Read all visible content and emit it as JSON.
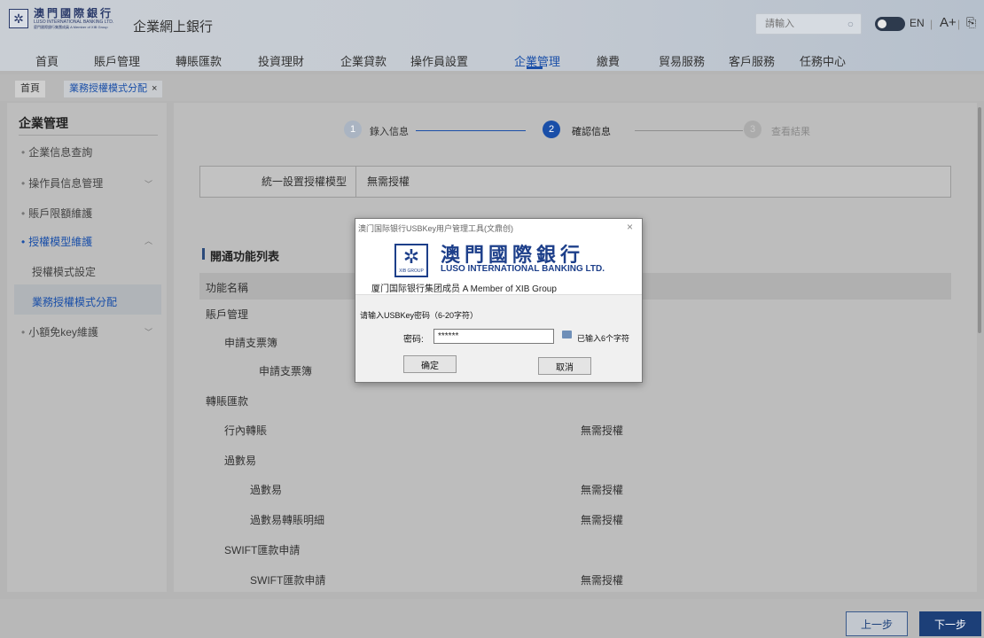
{
  "header": {
    "logo_cn": "澳門國際銀行",
    "logo_en": "LUSO INTERNATIONAL BANKING LTD.",
    "logo_sub": "廈門國際銀行集團成員 A Member of XIB Group",
    "site_name": "企業網上銀行",
    "search_placeholder": "請輸入",
    "lang": "EN",
    "font_size": "A+",
    "nav": [
      {
        "label": "首頁"
      },
      {
        "label": "賬戶管理"
      },
      {
        "label": "轉賬匯款"
      },
      {
        "label": "投資理財"
      },
      {
        "label": "企業貸款"
      },
      {
        "label": "操作員設置"
      },
      {
        "label": "企業管理",
        "active": true
      },
      {
        "label": "繳費"
      },
      {
        "label": "貿易服務"
      },
      {
        "label": "客戶服務"
      },
      {
        "label": "任務中心"
      }
    ]
  },
  "tabs": {
    "home": "首頁",
    "active": "業務授權模式分配",
    "close": "×"
  },
  "sidebar": {
    "title": "企業管理",
    "items": [
      {
        "label": "企業信息查詢"
      },
      {
        "label": "操作員信息管理"
      },
      {
        "label": "賬戶限額維護"
      },
      {
        "label": "授權模型維護",
        "expanded": true
      },
      {
        "label": "小額免key維護"
      }
    ],
    "sub_items": [
      {
        "label": "授權模式設定"
      },
      {
        "label": "業務授權模式分配",
        "active": true
      }
    ]
  },
  "steps": [
    {
      "num": "1",
      "label": "錄入信息",
      "state": "done"
    },
    {
      "num": "2",
      "label": "確認信息",
      "state": "current"
    },
    {
      "num": "3",
      "label": "查看結果",
      "state": "pending"
    }
  ],
  "setting": {
    "label": "統一設置授權模型",
    "value": "無需授權"
  },
  "section_title": "開通功能列表",
  "table": {
    "header": "功能名稱",
    "rows": [
      {
        "name": "賬戶管理",
        "level": 0,
        "value": ""
      },
      {
        "name": "申請支票簿",
        "level": 1,
        "value": ""
      },
      {
        "name": "申請支票簿",
        "level": 2,
        "value": ""
      },
      {
        "name": "轉賬匯款",
        "level": 0,
        "value": ""
      },
      {
        "name": "行內轉賬",
        "level": 1,
        "value": "無需授權"
      },
      {
        "name": "過數易",
        "level": 1,
        "value": ""
      },
      {
        "name": "過數易",
        "level": 2,
        "value": "無需授權"
      },
      {
        "name": "過數易轉賬明細",
        "level": 2,
        "value": "無需授權"
      },
      {
        "name": "SWIFT匯款申請",
        "level": 1,
        "value": ""
      },
      {
        "name": "SWIFT匯款申請",
        "level": 2,
        "value": "無需授權"
      }
    ]
  },
  "footer": {
    "prev": "上一步",
    "next": "下一步"
  },
  "modal": {
    "title": "澳门国际银行USBKey用户管理工具(文鼎创)",
    "close": "×",
    "bank_cn": "澳門國際銀行",
    "bank_en": "LUSO INTERNATIONAL BANKING LTD.",
    "group": "厦门国际银行集团成员 A Member of XIB Group",
    "mark_sub": "XIB GROUP",
    "prompt": "请输入USBKey密码（6-20字符）",
    "pwd_label": "密码:",
    "pwd_value": "******",
    "pwd_count": "已输入6个字符",
    "ok": "确定",
    "cancel": "取消"
  },
  "colors": {
    "accent": "#1a4fa8",
    "dark_blue": "#1c3f78"
  }
}
